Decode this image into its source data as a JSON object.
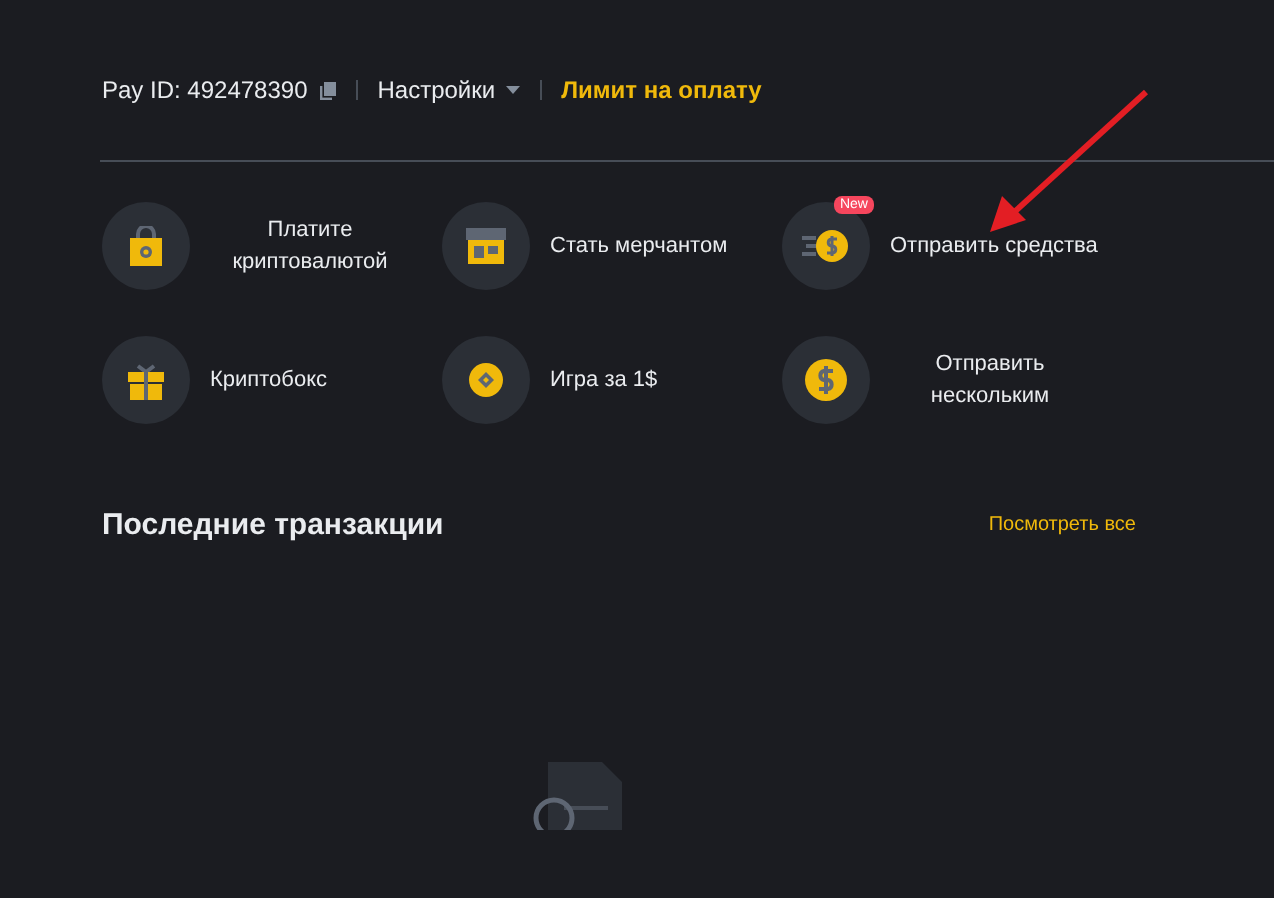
{
  "header": {
    "pay_id": "Pay ID: 492478390",
    "settings": "Настройки",
    "limit_link": "Лимит на оплату"
  },
  "actions": [
    {
      "kind": "bag",
      "label": "Платите\nкриптовалютой"
    },
    {
      "kind": "shop",
      "label": "Стать мерчантом"
    },
    {
      "kind": "send",
      "label": "Отправить средства",
      "badge": "New"
    },
    {
      "kind": "gift",
      "label": "Криптобокс"
    },
    {
      "kind": "coin",
      "label": "Игра за 1$"
    },
    {
      "kind": "dollar",
      "label": "Отправить\nнескольким"
    }
  ],
  "transactions": {
    "title": "Последние транзакции",
    "view_all": "Посмотреть все"
  }
}
